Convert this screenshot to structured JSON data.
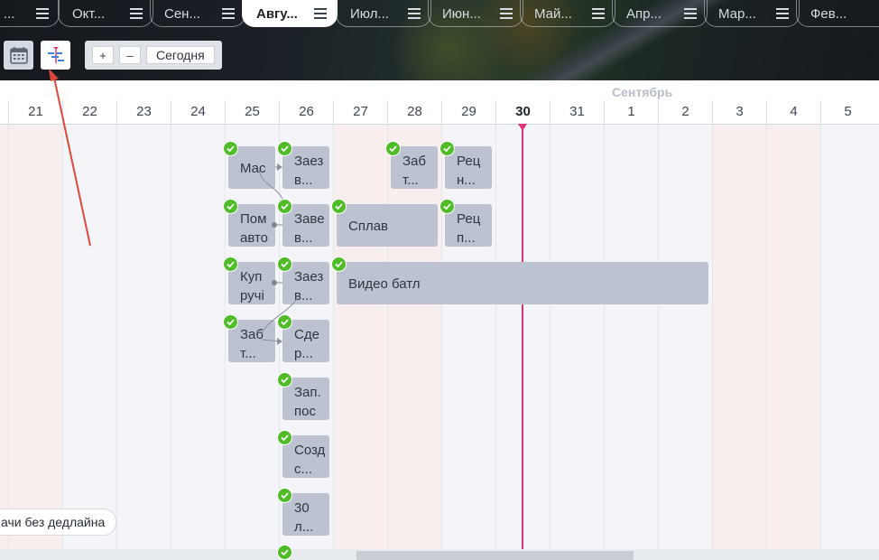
{
  "tabs": [
    {
      "label": "..."
    },
    {
      "label": "Окт..."
    },
    {
      "label": "Сен..."
    },
    {
      "label": "Авгу..."
    },
    {
      "label": "Июл..."
    },
    {
      "label": "Июн..."
    },
    {
      "label": "Май..."
    },
    {
      "label": "Апр..."
    },
    {
      "label": "Мар..."
    },
    {
      "label": "Фев..."
    }
  ],
  "toolbar": {
    "zoom_in_label": "+",
    "zoom_out_label": "–",
    "today_label": "Сегодня"
  },
  "header": {
    "month_label": "Сентябрь",
    "days": [
      "21",
      "22",
      "23",
      "24",
      "25",
      "26",
      "27",
      "28",
      "29",
      "30",
      "31",
      "1",
      "2",
      "3",
      "4",
      "5"
    ],
    "today": "30"
  },
  "tasks": [
    {
      "text": "Мас"
    },
    {
      "text": "Заез",
      "text2": "в..."
    },
    {
      "text": "Заб",
      "text2": "т..."
    },
    {
      "text": "Рец",
      "text2": "н..."
    },
    {
      "text": "Пом",
      "text2": "авто"
    },
    {
      "text": "Заве",
      "text2": "в..."
    },
    {
      "text": "Сплав"
    },
    {
      "text": "Рец",
      "text2": "п..."
    },
    {
      "text": "Куп",
      "text2": "ручі"
    },
    {
      "text": "Заез",
      "text2": "в..."
    },
    {
      "text": "Видео батл"
    },
    {
      "text": "Заб",
      "text2": "т..."
    },
    {
      "text": "Сде",
      "text2": "р..."
    },
    {
      "text": "Зап.",
      "text2": "пос"
    },
    {
      "text": "Созд",
      "text2": "с..."
    },
    {
      "text": "30",
      "text2": "л..."
    }
  ],
  "no_deadline_label": "ачи без дедлайна",
  "colors": {
    "today_line": "#e0347a",
    "check": "#4fbd27",
    "task": "#bcc2cf",
    "weekend": "#f8eeee",
    "annotation_arrow": "#e0473a"
  }
}
